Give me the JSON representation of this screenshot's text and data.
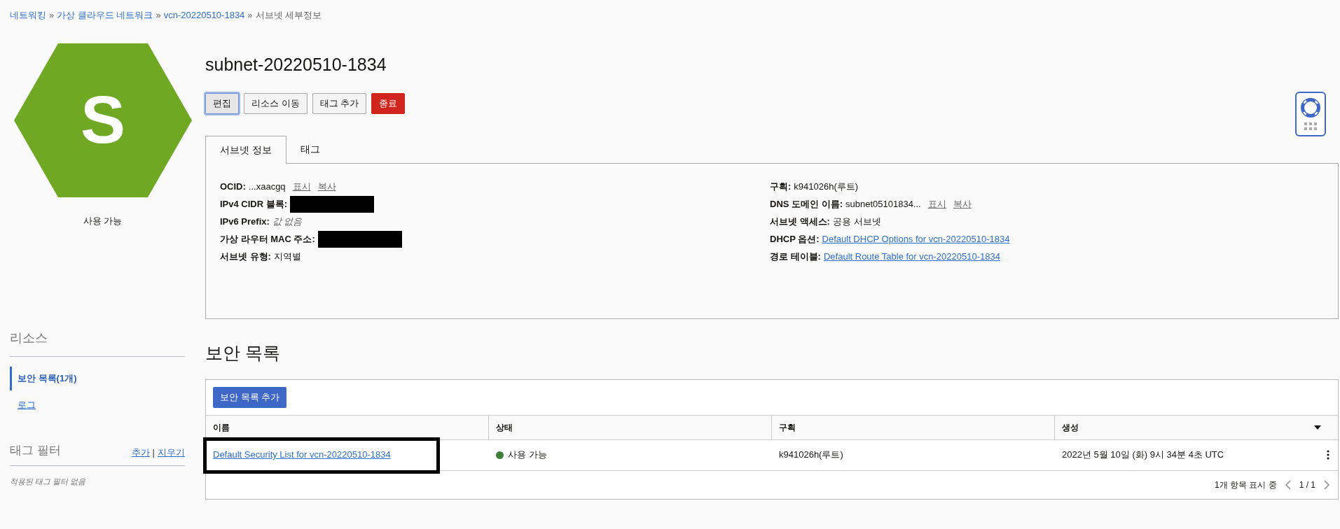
{
  "breadcrumb": [
    {
      "label": "네트워킹",
      "kind": "link"
    },
    {
      "label": "가상 클라우드 네트워크",
      "kind": "link"
    },
    {
      "label": "vcn-20220510-1834",
      "kind": "link"
    },
    {
      "label": "서브넷 세부정보",
      "kind": "current"
    }
  ],
  "breadcrumb_separator": "»",
  "resource_icon": {
    "letter": "S",
    "status": "사용 가능"
  },
  "title": "subnet-20220510-1834",
  "actions": [
    {
      "label": "편집",
      "kind": "focused"
    },
    {
      "label": "리소스 이동",
      "kind": "default"
    },
    {
      "label": "태그 추가",
      "kind": "default"
    },
    {
      "label": "종료",
      "kind": "danger"
    }
  ],
  "tabs": [
    {
      "label": "서브넷 정보",
      "selected": true
    },
    {
      "label": "태그",
      "selected": false
    }
  ],
  "details_left": [
    {
      "label": "OCID:",
      "kind": "text",
      "value": "...xaacgq",
      "links": [
        "표시",
        "복사"
      ]
    },
    {
      "label": "IPv4 CIDR 블록:",
      "kind": "redacted"
    },
    {
      "label": "IPv6 Prefix:",
      "kind": "empty",
      "value": "값 없음"
    },
    {
      "label": "가상 라우터 MAC 주소:",
      "kind": "redacted"
    },
    {
      "label": "서브넷 유형:",
      "kind": "text",
      "value": "지역별"
    }
  ],
  "details_right": [
    {
      "label": "구획:",
      "kind": "text",
      "value": "k941026h(루트)"
    },
    {
      "label": "DNS 도메인 이름:",
      "kind": "text",
      "value": "subnet05101834...",
      "links": [
        "표시",
        "복사"
      ]
    },
    {
      "label": "서브넷 액세스:",
      "kind": "text",
      "value": "공용 서브넷"
    },
    {
      "label": "DHCP 옵션:",
      "kind": "link",
      "value": "Default DHCP Options for vcn-20220510-1834"
    },
    {
      "label": "경로 테이블:",
      "kind": "link",
      "value": "Default Route Table for vcn-20220510-1834"
    }
  ],
  "sidebar": {
    "title": "리소스",
    "items": [
      {
        "label": "보안 목록(1개)",
        "selected": true
      },
      {
        "label": "로그",
        "selected": false
      }
    ],
    "tag_filter": {
      "title": "태그 필터",
      "add": "추가",
      "separator": "|",
      "clear": "지우기",
      "empty": "적용된 태그 필터 없음"
    }
  },
  "section_title": "보안 목록",
  "add_button": "보안 목록 추가",
  "table": {
    "columns": [
      "이름",
      "상태",
      "구획",
      "생성"
    ],
    "rows": [
      {
        "name": "Default Security List for vcn-20220510-1834",
        "highlighted": true,
        "status": "사용 가능",
        "color": "#3f7f3a",
        "compartment": "k941026h(루트)",
        "created": "2022년 5월 10일 (화) 9시 34분 4초 UTC"
      }
    ],
    "footer": "1개 항목 표시 중",
    "page": "1 / 1"
  }
}
